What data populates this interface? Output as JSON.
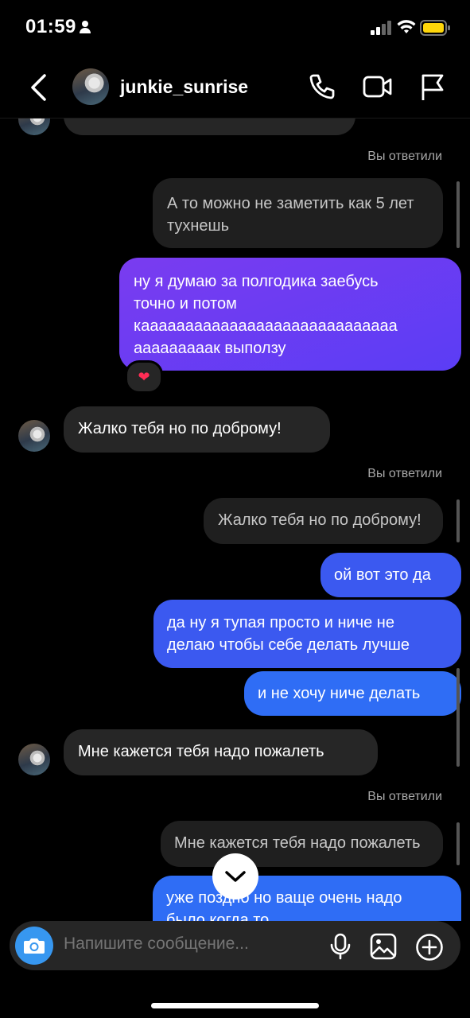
{
  "status": {
    "time": "01:59"
  },
  "header": {
    "username": "junkie_sunrise"
  },
  "labels": {
    "you_replied": "Вы ответили"
  },
  "messages": {
    "out1": "ну я думаю за полгодика заебусь\nточно и потом\nкааааааааааааааааааааааааааааа\nааааааааак выползу",
    "in1": "Жалко тебя но по доброму!",
    "out2": "ой вот это да",
    "out3": "да ну я тупая просто и ниче не\nделаю чтобы себе делать лучше",
    "out4": "и не хочу ниче делать",
    "in2": "Мне кажется тебя надо пожалеть",
    "out5": "уже поздно но ваще очень надо\nбыло когда то"
  },
  "replies": {
    "r1": "А то можно не заметить как 5 лет\nтухнешь",
    "r2": "Жалко тебя но по доброму!",
    "r3": "Мне кажется тебя надо пожалеть"
  },
  "reaction": "❤",
  "composer": {
    "placeholder": "Напишите сообщение..."
  },
  "colors": {
    "accent": "#3797f0",
    "bubble_in": "#262626",
    "bubble_out": "#3b59f0"
  }
}
